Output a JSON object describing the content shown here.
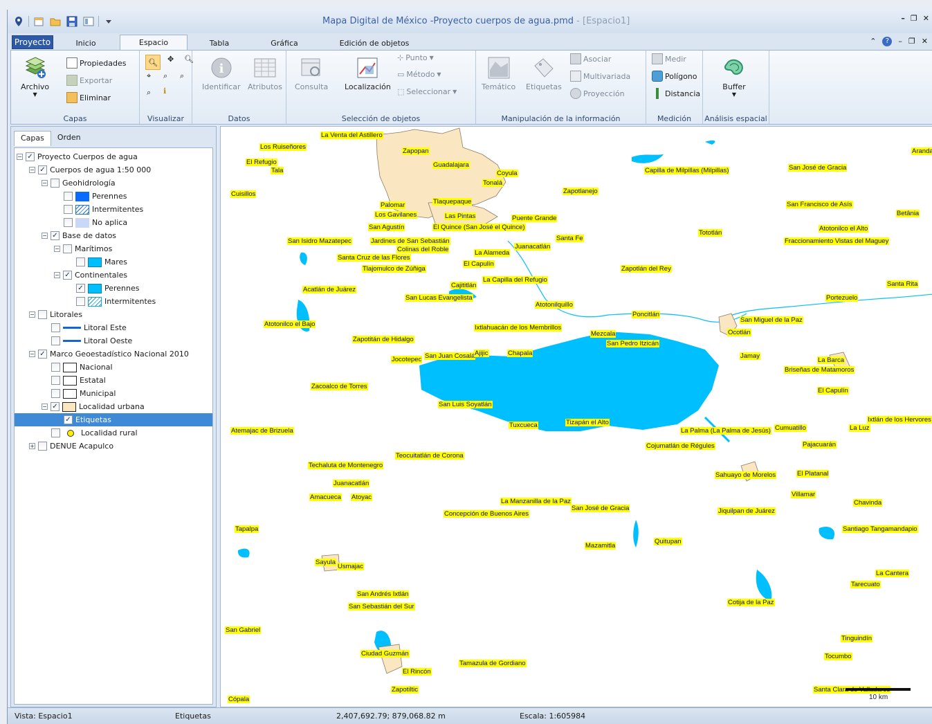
{
  "window": {
    "title": "Mapa Digital de México -Proyecto cuerpos de agua.pmd",
    "subtitle": " - [Espacio1]"
  },
  "tabs": [
    {
      "label": "Proyecto"
    },
    {
      "label": "Inicio"
    },
    {
      "label": "Espacio"
    },
    {
      "label": "Tabla"
    },
    {
      "label": "Gráfica"
    },
    {
      "label": "Edición de objetos"
    }
  ],
  "ribbon": {
    "capas": {
      "label": "Capas",
      "archivo": "Archivo",
      "propiedades": "Propiedades",
      "exportar": "Exportar",
      "eliminar": "Eliminar"
    },
    "visualizar": {
      "label": "Visualizar"
    },
    "datos": {
      "label": "Datos",
      "identificar": "Identificar",
      "atributos": "Atributos"
    },
    "seleccion": {
      "label": "Selección de objetos",
      "consulta": "Consulta",
      "localizacion": "Localización",
      "punto": "Punto",
      "metodo": "Método",
      "seleccionar": "Seleccionar"
    },
    "manipulacion": {
      "label": "Manipulación de la información",
      "tematico": "Temático",
      "etiquetas": "Etiquetas",
      "asociar": "Asociar",
      "multivariada": "Multivariada",
      "proyeccion": "Proyección"
    },
    "medicion": {
      "label": "Medición",
      "medir": "Medir",
      "poligono": "Polígono",
      "distancia": "Distancia"
    },
    "analisis": {
      "label": "Análisis espacial",
      "buffer": "Buffer"
    }
  },
  "panel": {
    "tabs": [
      "Capas",
      "Orden"
    ],
    "tree": [
      {
        "label": "Proyecto Cuerpos de agua",
        "checked": true
      },
      {
        "label": "Cuerpos de agua 1:50 000",
        "checked": true
      },
      {
        "label": "Geohidrología",
        "checked": false
      },
      {
        "label": "Perennes",
        "checked": false
      },
      {
        "label": "Intermitentes",
        "checked": false
      },
      {
        "label": "No aplica",
        "checked": false
      },
      {
        "label": "Base de datos",
        "checked": true
      },
      {
        "label": "Marítimos",
        "checked": false
      },
      {
        "label": "Mares",
        "checked": false
      },
      {
        "label": "Continentales",
        "checked": true
      },
      {
        "label": "Perennes",
        "checked": true
      },
      {
        "label": "Intermitentes",
        "checked": false
      },
      {
        "label": "Litorales",
        "checked": false
      },
      {
        "label": "Litoral Este",
        "checked": false
      },
      {
        "label": "Litoral Oeste",
        "checked": false
      },
      {
        "label": "Marco Geoestadístico Nacional 2010",
        "checked": true
      },
      {
        "label": "Nacional",
        "checked": false
      },
      {
        "label": "Estatal",
        "checked": false
      },
      {
        "label": "Municipal",
        "checked": false
      },
      {
        "label": "Localidad urbana",
        "checked": true
      },
      {
        "label": "Etiquetas",
        "checked": true
      },
      {
        "label": "Localidad rural",
        "checked": false
      },
      {
        "label": "DENUE Acapulco",
        "checked": false
      }
    ]
  },
  "map": {
    "labels": [
      "La Venta del Astillero",
      "Los Ruiseñores",
      "Zapopan",
      "El Refugio",
      "Tala",
      "Guadalajara",
      "Coyula",
      "Tonalá",
      "Zapotlanejo",
      "Capilla de Milpillas (Milpillas)",
      "San José de Gracia",
      "Aranda",
      "Cuisillos",
      "Tlaquepaque",
      "Palomar",
      "Los Gavilanes",
      "Las Pintas",
      "Puente Grande",
      "San Agustín",
      "El Quince (San José el Quince)",
      "San Francisco de Asís",
      "Betânia",
      "San Isidro Mazatepec",
      "Jardines de San Sebastián",
      "Colinas del Roble",
      "Juanacatlán",
      "Santa Fe",
      "Tototlán",
      "Atotonilco el Alto",
      "Fraccionamiento Vistas del Maguey",
      "La Alameda",
      "Santa Cruz de las Flores",
      "El Capulín",
      "Tlajomulco de Zúñiga",
      "Zapotlán del Rey",
      "Cajititlán",
      "La Capilla del Refugio",
      "Acatlán de Juárez",
      "San Lucas Evangelista",
      "Santa Rita",
      "Portezuelo",
      "Atotonilquillo",
      "Poncitlán",
      "San Miguel de la Paz",
      "Atotonilco el Bajo",
      "Ixtlahuacán de los Membrillos",
      "Ocotlán",
      "Zapotitán de Hidalgo",
      "Mezcala",
      "San Pedro Itzicán",
      "Jamay",
      "Jocotepec",
      "San Juan Cosalá",
      "Ajijic",
      "Chapala",
      "La Barca",
      "Briseñas de Matamoros",
      "Zacoalco de Torres",
      "El Capulín",
      "San Luis Soyatlán",
      "Ixtlán de los Hervores",
      "Atemajac de Brizuela",
      "Tuxcueca",
      "Tizapán el Alto",
      "La Palma (La Palma de Jesús)",
      "Cumuatillo",
      "La Luz",
      "Cojumatlán de Régules",
      "Pajacuarán",
      "Teocuitatlán de Corona",
      "Techaluta de Montenegro",
      "Sahuayo de Morelos",
      "El Platanal",
      "Juanacatlán",
      "Villamar",
      "Amacueca",
      "Atoyac",
      "La Manzanilla de la Paz",
      "San José de Gracia",
      "Chavinda",
      "Jiquilpan de Juárez",
      "Concepción de Buenos Aires",
      "Tapalpa",
      "Santiago Tangamandapio",
      "Mazamitla",
      "Quitupan",
      "Sayula",
      "Usmajac",
      "La Cantera",
      "Tarecuato",
      "San Andrés Ixtlán",
      "San Sebastián del Sur",
      "Cotija de la Paz",
      "San Gabriel",
      "Tinguindín",
      "Ciudad Guzmán",
      "Tocumbo",
      "Tamazula de Gordiano",
      "El Rincón",
      "Zapotiltic",
      "Santa Clara de Valladares",
      "Cópala"
    ],
    "scale_label": "10 km"
  },
  "status": {
    "vista": "Vista: Espacio1",
    "capa": "Etiquetas",
    "coords": "2,407,692.79; 879,068.82 m",
    "escala": "Escala: 1:605984"
  },
  "colors": {
    "water": "#00bfff",
    "urban": "#fbe6c2",
    "label_bg": "#ffff00",
    "selection": "#3f8ad6",
    "project_tab": "#2c5aa8"
  },
  "icons": {
    "map_pin": "map-pin-icon",
    "folder": "folder-icon",
    "save": "save-icon"
  }
}
